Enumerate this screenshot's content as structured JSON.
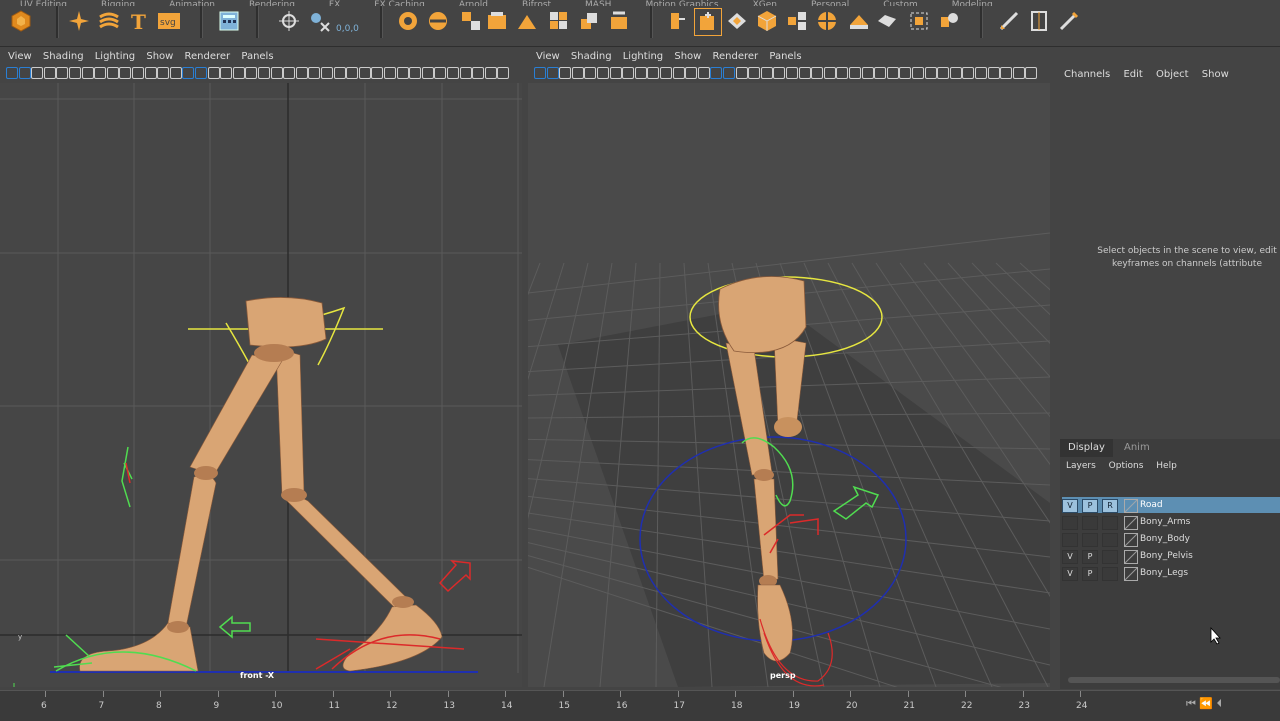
{
  "shelf": {
    "tabs": [
      "UV Editing",
      "Rigging",
      "Animation",
      "Rendering",
      "FX",
      "FX Caching",
      "Arnold",
      "Bifrost",
      "MASH",
      "Motion Graphics",
      "XGen",
      "Personal",
      "Custom",
      "Modeling"
    ],
    "tools": [
      "maya-logo-icon",
      "star-tool-icon",
      "sweep-icon",
      "text-icon",
      "svg-icon",
      "calculator-icon",
      "locator-icon",
      "constraint-icon",
      "coords-readout",
      "lattice-icon",
      "wrap-icon",
      "cube-tool-icon",
      "poly-cube-icon",
      "bend-icon",
      "bevel-icon",
      "extrude-icon",
      "combine-icon",
      "separate-icon",
      "mesh-icon",
      "retopo-icon",
      "uv-sphere-icon",
      "crease-icon",
      "mirror-icon",
      "bridge-icon",
      "draw-icon",
      "select-icon",
      "pencil-icon"
    ],
    "coords_label": "0,0,0"
  },
  "front": {
    "menu": [
      "View",
      "Shading",
      "Lighting",
      "Show",
      "Renderer",
      "Panels"
    ],
    "camera": "front -X"
  },
  "persp": {
    "menu": [
      "View",
      "Shading",
      "Lighting",
      "Show",
      "Renderer",
      "Panels"
    ],
    "camera": "persp"
  },
  "channel_box": {
    "menu": [
      "Channels",
      "Edit",
      "Object",
      "Show"
    ],
    "hint_line1": "Select objects in the scene to view, edit",
    "hint_line2": "keyframes on channels (attribute"
  },
  "layers": {
    "tabs": [
      "Display",
      "Anim"
    ],
    "menu": [
      "Layers",
      "Options",
      "Help"
    ],
    "rows": [
      {
        "v": "V",
        "p": "P",
        "r": "R",
        "name": "Road",
        "selected": true
      },
      {
        "v": "",
        "p": "",
        "r": "",
        "name": "Bony_Arms",
        "selected": false
      },
      {
        "v": "",
        "p": "",
        "r": "",
        "name": "Bony_Body",
        "selected": false
      },
      {
        "v": "V",
        "p": "P",
        "r": "",
        "name": "Bony_Pelvis",
        "selected": false
      },
      {
        "v": "V",
        "p": "P",
        "r": "",
        "name": "Bony_Legs",
        "selected": false
      }
    ]
  },
  "timeline": {
    "frames": [
      "6",
      "7",
      "8",
      "9",
      "10",
      "11",
      "12",
      "13",
      "14",
      "15",
      "16",
      "17",
      "18",
      "19",
      "20",
      "21",
      "22",
      "23",
      "24"
    ]
  },
  "colors": {
    "selected_layer": "#5d8fb3",
    "skin": "#d9a574",
    "nurbs_yellow": "#e6e640",
    "nurbs_green": "#50dc50",
    "nurbs_red": "#dc2a2a",
    "nurbs_blue": "#1f2fb0"
  }
}
